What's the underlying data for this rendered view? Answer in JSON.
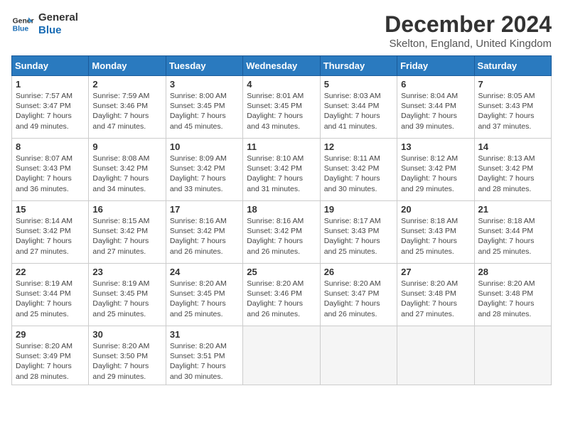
{
  "logo": {
    "line1": "General",
    "line2": "Blue"
  },
  "title": "December 2024",
  "location": "Skelton, England, United Kingdom",
  "days_header": [
    "Sunday",
    "Monday",
    "Tuesday",
    "Wednesday",
    "Thursday",
    "Friday",
    "Saturday"
  ],
  "weeks": [
    [
      {
        "day": "1",
        "info": "Sunrise: 7:57 AM\nSunset: 3:47 PM\nDaylight: 7 hours\nand 49 minutes."
      },
      {
        "day": "2",
        "info": "Sunrise: 7:59 AM\nSunset: 3:46 PM\nDaylight: 7 hours\nand 47 minutes."
      },
      {
        "day": "3",
        "info": "Sunrise: 8:00 AM\nSunset: 3:45 PM\nDaylight: 7 hours\nand 45 minutes."
      },
      {
        "day": "4",
        "info": "Sunrise: 8:01 AM\nSunset: 3:45 PM\nDaylight: 7 hours\nand 43 minutes."
      },
      {
        "day": "5",
        "info": "Sunrise: 8:03 AM\nSunset: 3:44 PM\nDaylight: 7 hours\nand 41 minutes."
      },
      {
        "day": "6",
        "info": "Sunrise: 8:04 AM\nSunset: 3:44 PM\nDaylight: 7 hours\nand 39 minutes."
      },
      {
        "day": "7",
        "info": "Sunrise: 8:05 AM\nSunset: 3:43 PM\nDaylight: 7 hours\nand 37 minutes."
      }
    ],
    [
      {
        "day": "8",
        "info": "Sunrise: 8:07 AM\nSunset: 3:43 PM\nDaylight: 7 hours\nand 36 minutes."
      },
      {
        "day": "9",
        "info": "Sunrise: 8:08 AM\nSunset: 3:42 PM\nDaylight: 7 hours\nand 34 minutes."
      },
      {
        "day": "10",
        "info": "Sunrise: 8:09 AM\nSunset: 3:42 PM\nDaylight: 7 hours\nand 33 minutes."
      },
      {
        "day": "11",
        "info": "Sunrise: 8:10 AM\nSunset: 3:42 PM\nDaylight: 7 hours\nand 31 minutes."
      },
      {
        "day": "12",
        "info": "Sunrise: 8:11 AM\nSunset: 3:42 PM\nDaylight: 7 hours\nand 30 minutes."
      },
      {
        "day": "13",
        "info": "Sunrise: 8:12 AM\nSunset: 3:42 PM\nDaylight: 7 hours\nand 29 minutes."
      },
      {
        "day": "14",
        "info": "Sunrise: 8:13 AM\nSunset: 3:42 PM\nDaylight: 7 hours\nand 28 minutes."
      }
    ],
    [
      {
        "day": "15",
        "info": "Sunrise: 8:14 AM\nSunset: 3:42 PM\nDaylight: 7 hours\nand 27 minutes."
      },
      {
        "day": "16",
        "info": "Sunrise: 8:15 AM\nSunset: 3:42 PM\nDaylight: 7 hours\nand 27 minutes."
      },
      {
        "day": "17",
        "info": "Sunrise: 8:16 AM\nSunset: 3:42 PM\nDaylight: 7 hours\nand 26 minutes."
      },
      {
        "day": "18",
        "info": "Sunrise: 8:16 AM\nSunset: 3:42 PM\nDaylight: 7 hours\nand 26 minutes."
      },
      {
        "day": "19",
        "info": "Sunrise: 8:17 AM\nSunset: 3:43 PM\nDaylight: 7 hours\nand 25 minutes."
      },
      {
        "day": "20",
        "info": "Sunrise: 8:18 AM\nSunset: 3:43 PM\nDaylight: 7 hours\nand 25 minutes."
      },
      {
        "day": "21",
        "info": "Sunrise: 8:18 AM\nSunset: 3:44 PM\nDaylight: 7 hours\nand 25 minutes."
      }
    ],
    [
      {
        "day": "22",
        "info": "Sunrise: 8:19 AM\nSunset: 3:44 PM\nDaylight: 7 hours\nand 25 minutes."
      },
      {
        "day": "23",
        "info": "Sunrise: 8:19 AM\nSunset: 3:45 PM\nDaylight: 7 hours\nand 25 minutes."
      },
      {
        "day": "24",
        "info": "Sunrise: 8:20 AM\nSunset: 3:45 PM\nDaylight: 7 hours\nand 25 minutes."
      },
      {
        "day": "25",
        "info": "Sunrise: 8:20 AM\nSunset: 3:46 PM\nDaylight: 7 hours\nand 26 minutes."
      },
      {
        "day": "26",
        "info": "Sunrise: 8:20 AM\nSunset: 3:47 PM\nDaylight: 7 hours\nand 26 minutes."
      },
      {
        "day": "27",
        "info": "Sunrise: 8:20 AM\nSunset: 3:48 PM\nDaylight: 7 hours\nand 27 minutes."
      },
      {
        "day": "28",
        "info": "Sunrise: 8:20 AM\nSunset: 3:48 PM\nDaylight: 7 hours\nand 28 minutes."
      }
    ],
    [
      {
        "day": "29",
        "info": "Sunrise: 8:20 AM\nSunset: 3:49 PM\nDaylight: 7 hours\nand 28 minutes."
      },
      {
        "day": "30",
        "info": "Sunrise: 8:20 AM\nSunset: 3:50 PM\nDaylight: 7 hours\nand 29 minutes."
      },
      {
        "day": "31",
        "info": "Sunrise: 8:20 AM\nSunset: 3:51 PM\nDaylight: 7 hours\nand 30 minutes."
      },
      null,
      null,
      null,
      null
    ]
  ]
}
